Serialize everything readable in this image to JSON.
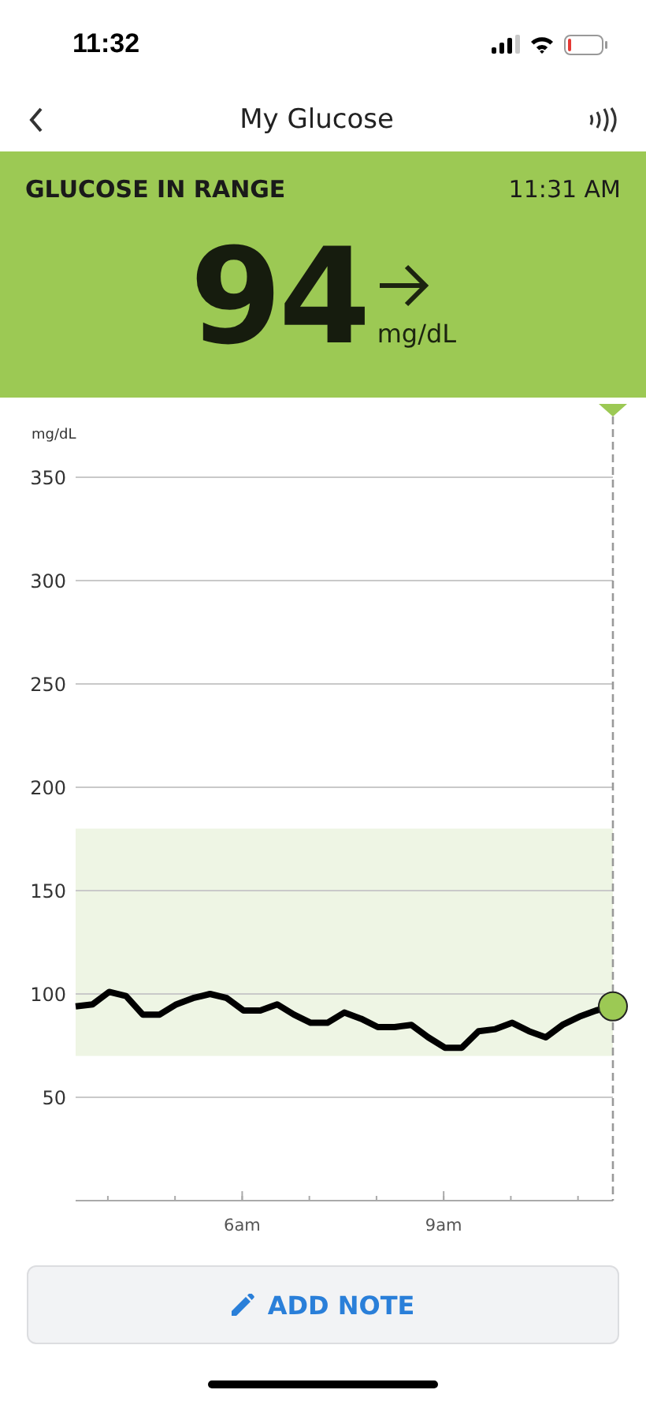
{
  "status_bar": {
    "time": "11:32"
  },
  "nav": {
    "title": "My Glucose"
  },
  "reading": {
    "status": "GLUCOSE IN RANGE",
    "time": "11:31 AM",
    "value": "94",
    "unit": "mg/dL",
    "arrow": {
      "kind": "steady"
    }
  },
  "chart": {
    "chart_data": {
      "type": "line",
      "ylabel": "mg/dL",
      "grid": true,
      "xlim": [
        3.52,
        11.52
      ],
      "ylim": [
        0,
        350
      ],
      "yticks": [
        50,
        100,
        150,
        200,
        250,
        300,
        350
      ],
      "xticks": [
        {
          "value": 6,
          "label": "6am"
        },
        {
          "value": 9,
          "label": "9am"
        }
      ],
      "x": [
        3.52,
        3.77,
        4.02,
        4.27,
        4.52,
        4.77,
        5.02,
        5.27,
        5.52,
        5.77,
        6.02,
        6.27,
        6.52,
        6.77,
        7.02,
        7.27,
        7.52,
        7.77,
        8.02,
        8.27,
        8.52,
        8.77,
        9.02,
        9.27,
        9.52,
        9.77,
        10.02,
        10.27,
        10.52,
        10.77,
        11.02,
        11.27,
        11.52
      ],
      "series": [
        {
          "color": "#000000",
          "values": [
            94,
            95,
            101,
            99,
            90,
            90,
            95,
            98,
            100,
            98,
            92,
            92,
            95,
            90,
            86,
            86,
            91,
            88,
            84,
            84,
            85,
            79,
            74,
            74,
            82,
            83,
            86,
            82,
            79,
            85,
            89,
            92,
            94
          ]
        }
      ],
      "bands": [
        {
          "axis": "y",
          "from": 70,
          "to": 180,
          "color": "#eef5e4"
        }
      ]
    }
  },
  "button": {
    "label": "ADD NOTE"
  }
}
